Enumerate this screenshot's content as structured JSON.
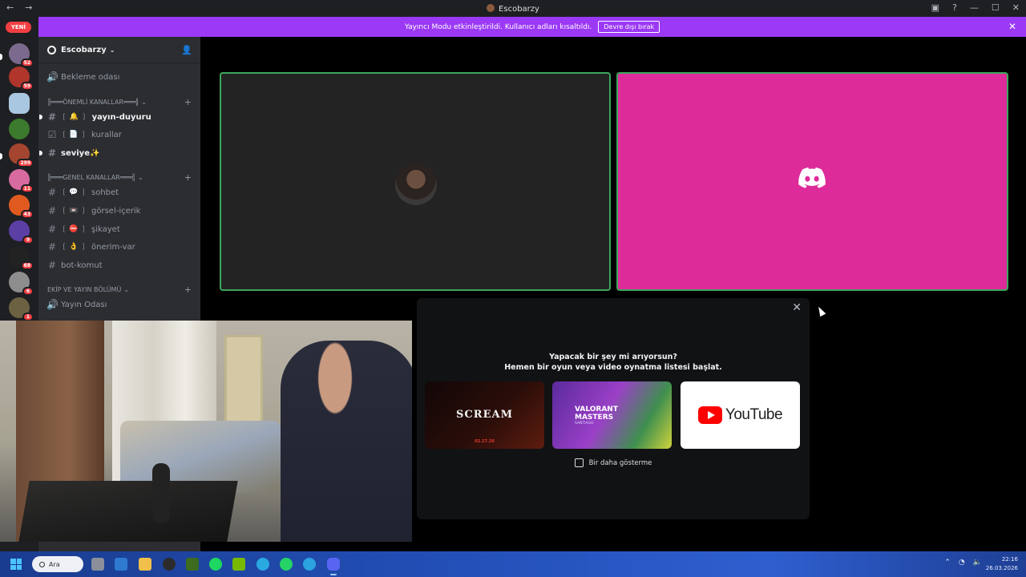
{
  "window": {
    "title": "Escobarzy",
    "back_glyph": "←",
    "forward_glyph": "→",
    "inbox_glyph": "▣",
    "help_glyph": "?",
    "minimize_glyph": "—",
    "maximize_glyph": "☐",
    "close_glyph": "✕"
  },
  "servers": {
    "new_badge": "YENİ",
    "list": [
      {
        "count": "52",
        "color": "#7b6a8d"
      },
      {
        "count": "59",
        "color": "#b0352b"
      },
      {
        "count": "",
        "color": "#a9c7e0"
      },
      {
        "count": "",
        "color": "#3c7a2d"
      },
      {
        "count": "299",
        "color": "#a4462f"
      },
      {
        "count": "11",
        "color": "#d76ba0"
      },
      {
        "count": "43",
        "color": "#e05a1f"
      },
      {
        "count": "9",
        "color": "#5b3fa5"
      },
      {
        "count": "68",
        "color": "#222222"
      },
      {
        "count": "6",
        "color": "#8d8d8d"
      },
      {
        "count": "1",
        "color": "#6c6242"
      }
    ]
  },
  "banner": {
    "message": "Yayıncı Modu etkinleştirildi. Kullanıcı adları kısaltıldı.",
    "button_label": "Devre dışı bırak",
    "close_glyph": "✕"
  },
  "guild": {
    "name": "Escobarzy",
    "caret": "⌄",
    "invite_glyph": "👤"
  },
  "channels": {
    "waiting_room": "Bekleme odası",
    "cat_important": "╠═══ÖNEMLİ KANALLAR═══╣",
    "yayin_duyuru": "yayın-duyuru",
    "yayin_duyuru_emoji": "❲ 🔔 ❳",
    "kurallar": "kurallar",
    "kurallar_emoji": "❲ 📄 ❳",
    "seviye": "seviye✨",
    "cat_general": "╠═══GENEL KANALLAR═══╣",
    "sohbet": "sohbet",
    "sohbet_emoji": "❲ 💬 ❳",
    "gorsel": "görsel-içerik",
    "gorsel_emoji": "❲ 📼 ❳",
    "sikayet": "şikayet",
    "sikayet_emoji": "❲ ⛔ ❳",
    "onerim": "önerim-var",
    "onerim_emoji": "❲ 👌 ❳",
    "bot_komut": "bot-komut",
    "cat_team": "EKİP VE YAYIN BÖLÜMÜ",
    "yayin_odasi": "Yayın Odası",
    "hash": "#",
    "plus": "+",
    "caret": "⌄",
    "speaker": "🔊"
  },
  "activity": {
    "close_glyph": "✕",
    "headline_line1": "Yapacak bir şey mi arıyorsun?",
    "headline_line2": "Hemen bir oyun veya video oynatma listesi başlat.",
    "cards": {
      "scream_title": "SCREAM",
      "scream_date": "02.27.26",
      "valorant_title_1": "VALORANT",
      "valorant_title_2": "MASTERS",
      "valorant_sub": "SANTIAGO",
      "youtube_word": "YouTube"
    },
    "dont_show": "Bir daha gösterme"
  },
  "taskbar": {
    "search_label": "Ara",
    "time": "22:16",
    "date": "26.03.2026",
    "tray_chevron": "⌃",
    "tray_wifi": "◔",
    "tray_volume": "🔈"
  },
  "colors": {
    "banner": "#9b39f5",
    "speaking_border": "#3ba55c",
    "brand_tile": "#dd2c99",
    "mention_badge": "#f23f43",
    "youtube_red": "#ff0000"
  }
}
